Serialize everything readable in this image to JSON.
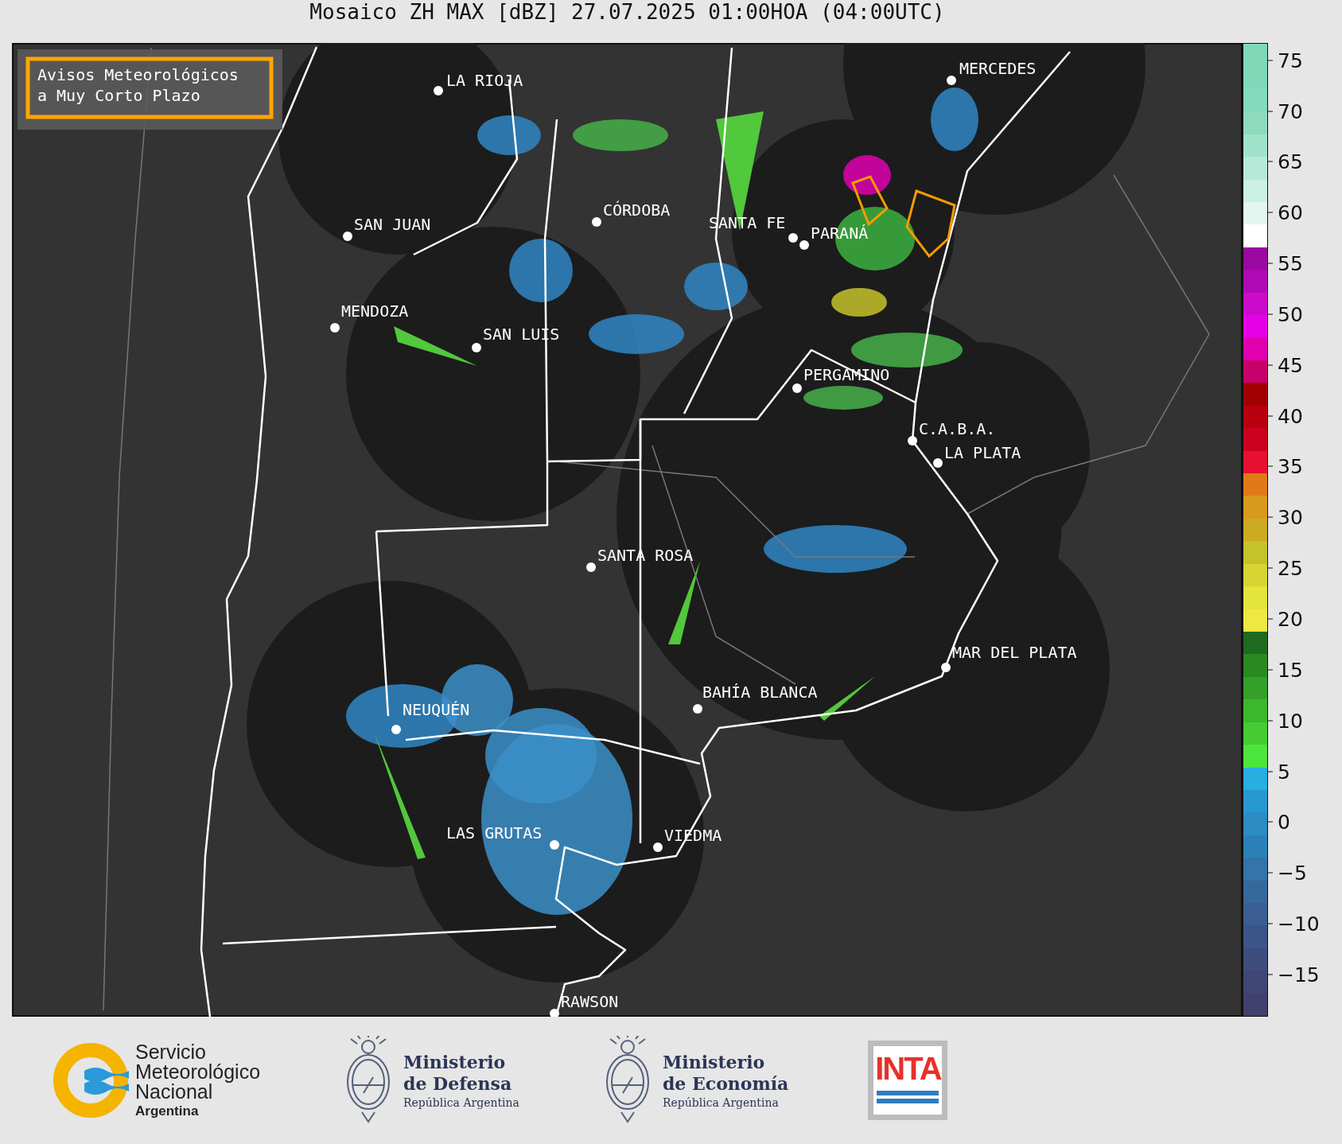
{
  "title": "Mosaico ZH MAX [dBZ] 27.07.2025 01:00HOA (04:00UTC)",
  "legend_box": {
    "lines": [
      "Avisos Meteorológicos",
      "a Muy Corto Plazo"
    ]
  },
  "cities": [
    {
      "name": "LA RIOJA"
    },
    {
      "name": "MERCEDES"
    },
    {
      "name": "SAN JUAN"
    },
    {
      "name": "CÓRDOBA"
    },
    {
      "name": "SANTA FE"
    },
    {
      "name": "PARANÁ"
    },
    {
      "name": "MENDOZA"
    },
    {
      "name": "SAN LUIS"
    },
    {
      "name": "PERGAMINO"
    },
    {
      "name": "C.A.B.A."
    },
    {
      "name": "LA PLATA"
    },
    {
      "name": "SANTA ROSA"
    },
    {
      "name": "MAR DEL PLATA"
    },
    {
      "name": "BAHÍA BLANCA"
    },
    {
      "name": "NEUQUÉN"
    },
    {
      "name": "LAS GRUTAS"
    },
    {
      "name": "VIEDMA"
    },
    {
      "name": "RAWSON"
    }
  ],
  "colorbar": {
    "segments": [
      {
        "color": "#7fd9b9"
      },
      {
        "color": "#7fd9b9"
      },
      {
        "color": "#84dabc"
      },
      {
        "color": "#8edbc0"
      },
      {
        "color": "#a0e3cb"
      },
      {
        "color": "#b5ead8"
      },
      {
        "color": "#cbf1e3"
      },
      {
        "color": "#e2f7ef"
      },
      {
        "color": "#ffffff"
      },
      {
        "color": "#9a0aa0"
      },
      {
        "color": "#b00ab6"
      },
      {
        "color": "#cc0acc"
      },
      {
        "color": "#e600e6"
      },
      {
        "color": "#e000b0"
      },
      {
        "color": "#c8006c"
      },
      {
        "color": "#a00000"
      },
      {
        "color": "#b80010"
      },
      {
        "color": "#cc0020"
      },
      {
        "color": "#e81030"
      },
      {
        "color": "#e07a18"
      },
      {
        "color": "#d89a1c"
      },
      {
        "color": "#ccaa22"
      },
      {
        "color": "#c6c22c"
      },
      {
        "color": "#d8d432"
      },
      {
        "color": "#e4e43a"
      },
      {
        "color": "#eee840"
      },
      {
        "color": "#1e6a1e"
      },
      {
        "color": "#2a8a22"
      },
      {
        "color": "#34a028"
      },
      {
        "color": "#3cb82c"
      },
      {
        "color": "#44cc32"
      },
      {
        "color": "#4ce63a"
      },
      {
        "color": "#28aee0"
      },
      {
        "color": "#2898d0"
      },
      {
        "color": "#2c8cc4"
      },
      {
        "color": "#2c80b8"
      },
      {
        "color": "#3474a8"
      },
      {
        "color": "#36689c"
      },
      {
        "color": "#3a5e92"
      },
      {
        "color": "#3c5488"
      },
      {
        "color": "#3e4c7e"
      },
      {
        "color": "#404676"
      },
      {
        "color": "#42406e"
      }
    ],
    "ticks": [
      "75",
      "70",
      "65",
      "60",
      "55",
      "50",
      "45",
      "40",
      "35",
      "30",
      "25",
      "20",
      "15",
      "10",
      "5",
      "0",
      "−5",
      "−10",
      "−15"
    ]
  },
  "footer": {
    "logos": [
      {
        "kind": "smn",
        "lines": [
          "Servicio",
          "Meteorológico",
          "Nacional",
          "Argentina"
        ]
      },
      {
        "kind": "ministry",
        "lines": [
          "Ministerio",
          "de Defensa",
          "República Argentina"
        ]
      },
      {
        "kind": "ministry",
        "lines": [
          "Ministerio",
          "de Economía",
          "República Argentina"
        ]
      },
      {
        "kind": "inta",
        "lines": [
          "INTA"
        ]
      }
    ]
  }
}
